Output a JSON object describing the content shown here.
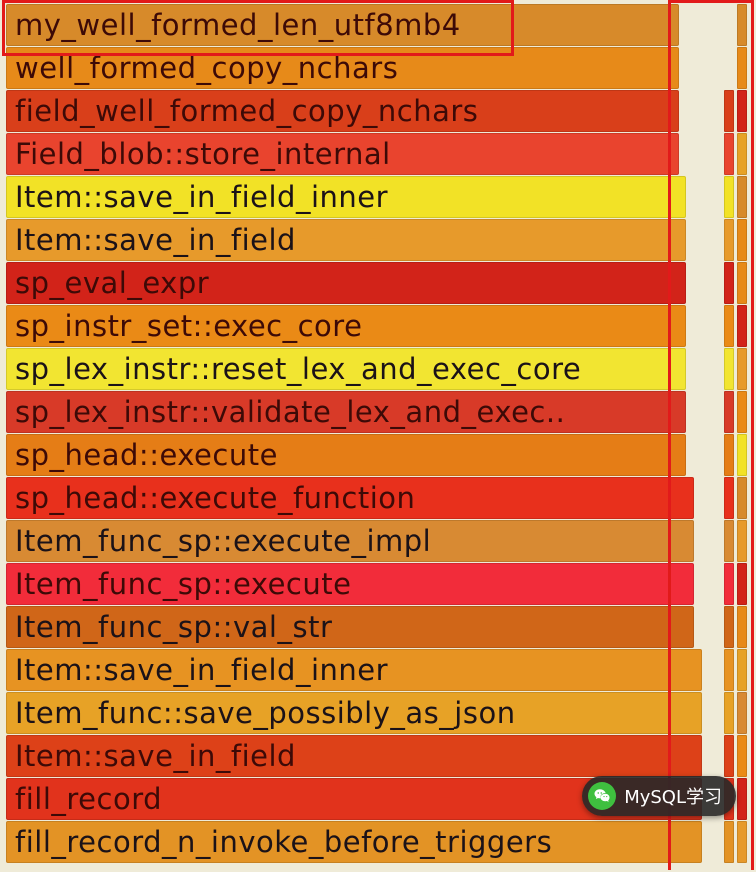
{
  "chart_data": {
    "type": "bar",
    "title": "",
    "xlabel": "",
    "ylabel": "",
    "frames": [
      {
        "name": "my_well_formed_len_utf8mb4",
        "color": "#d78a2a",
        "text": "dark",
        "width_pct": 89
      },
      {
        "name": "well_formed_copy_nchars",
        "color": "#e78a19",
        "text": "dark",
        "width_pct": 89
      },
      {
        "name": "field_well_formed_copy_nchars",
        "color": "#d93f1a",
        "text": "dark",
        "width_pct": 89
      },
      {
        "name": "Field_blob::store_internal",
        "color": "#e9442e",
        "text": "dark",
        "width_pct": 89
      },
      {
        "name": "Item::save_in_field_inner",
        "color": "#f2e226",
        "text": "normal",
        "width_pct": 90
      },
      {
        "name": "Item::save_in_field",
        "color": "#e79a2b",
        "text": "normal",
        "width_pct": 90
      },
      {
        "name": "sp_eval_expr",
        "color": "#d22319",
        "text": "dark",
        "width_pct": 90
      },
      {
        "name": "sp_instr_set::exec_core",
        "color": "#ea8a16",
        "text": "dark",
        "width_pct": 90
      },
      {
        "name": "sp_lex_instr::reset_lex_and_exec_core",
        "color": "#f2e531",
        "text": "normal",
        "width_pct": 90
      },
      {
        "name": "sp_lex_instr::validate_lex_and_exec..",
        "color": "#d83a28",
        "text": "dark",
        "width_pct": 90
      },
      {
        "name": "sp_head::execute",
        "color": "#e57d16",
        "text": "dark",
        "width_pct": 90
      },
      {
        "name": "sp_head::execute_function",
        "color": "#e8301c",
        "text": "dark",
        "width_pct": 91
      },
      {
        "name": "Item_func_sp::execute_impl",
        "color": "#d88a33",
        "text": "normal",
        "width_pct": 91
      },
      {
        "name": "Item_func_sp::execute",
        "color": "#f22c3a",
        "text": "dark",
        "width_pct": 91
      },
      {
        "name": "Item_func_sp::val_str",
        "color": "#d06618",
        "text": "normal",
        "width_pct": 91
      },
      {
        "name": "Item::save_in_field_inner",
        "color": "#e79322",
        "text": "normal",
        "width_pct": 92
      },
      {
        "name": "Item_func::save_possibly_as_json",
        "color": "#e7a226",
        "text": "normal",
        "width_pct": 92
      },
      {
        "name": "Item::save_in_field",
        "color": "#dd4118",
        "text": "dark",
        "width_pct": 92
      },
      {
        "name": "fill_record",
        "color": "#e1331c",
        "text": "dark",
        "width_pct": 92
      },
      {
        "name": "fill_record_n_invoke_before_triggers",
        "color": "#e39325",
        "text": "normal",
        "width_pct": 92
      }
    ],
    "side_strips": [
      [
        "#d78a2a"
      ],
      [
        "#e78a19"
      ],
      [
        "#d93f1a",
        "#d22319"
      ],
      [
        "#e9442e",
        "#e7a226"
      ],
      [
        "#f2e226",
        "#d78a2a"
      ],
      [
        "#e79a2b",
        "#e78a19"
      ],
      [
        "#d22319",
        "#e78a19"
      ],
      [
        "#ea8a16",
        "#d22319"
      ],
      [
        "#f2e531",
        "#e79a2b"
      ],
      [
        "#d83a28",
        "#ea8a16"
      ],
      [
        "#e57d16",
        "#f2e226"
      ],
      [
        "#e8301c",
        "#d78a2a"
      ],
      [
        "#d88a33",
        "#e79a2b"
      ],
      [
        "#f22c3a",
        "#d22319"
      ],
      [
        "#d06618",
        "#e78a19"
      ],
      [
        "#e79322",
        "#e7a226"
      ],
      [
        "#e7a226",
        "#d88a33"
      ],
      [
        "#dd4118",
        "#ea8a16"
      ],
      [
        "#e1331c",
        "#d22319"
      ],
      [
        "#e39325",
        "#e79a2b"
      ]
    ]
  },
  "watermark": {
    "label": "MySQL学习"
  },
  "highlights": {
    "top_box": true,
    "right_box": true
  }
}
